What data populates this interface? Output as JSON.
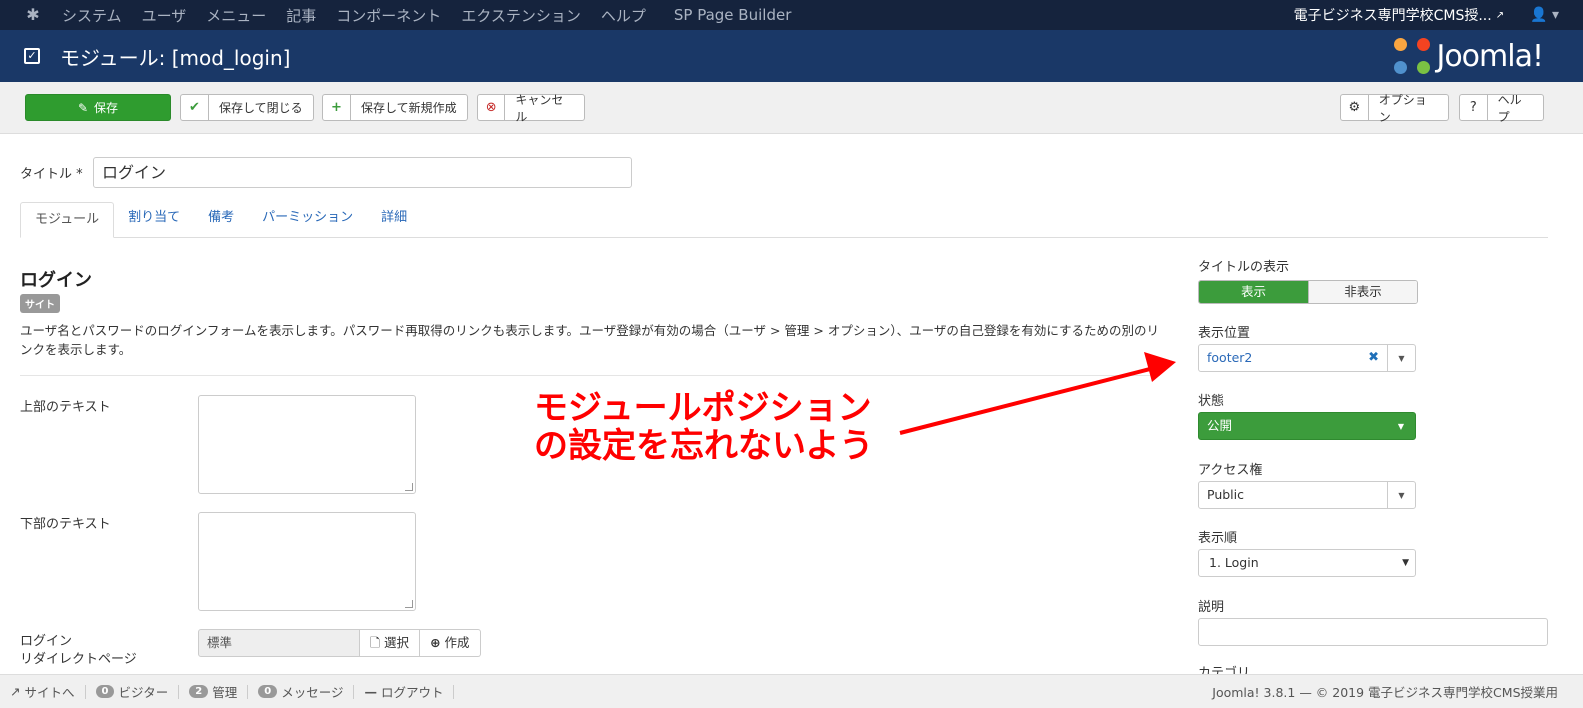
{
  "topnav": {
    "menu": [
      "システム",
      "ユーザ",
      "メニュー",
      "記事",
      "コンポーネント",
      "エクステンション",
      "ヘルプ"
    ],
    "extra": "SP Page Builder",
    "site_name": "電子ビジネス専門学校CMS授...",
    "user_icon": "user-icon"
  },
  "header": {
    "title": "モジュール: [mod_login]",
    "brand": "Joomla!"
  },
  "toolbar": {
    "save": "保存",
    "save_close": "保存して閉じる",
    "save_new": "保存して新規作成",
    "cancel": "キャンセル",
    "options": "オプション",
    "help": "ヘルプ"
  },
  "form": {
    "title_label": "タイトル *",
    "title_value": "ログイン",
    "tabs": [
      "モジュール",
      "割り当て",
      "備考",
      "パーミッション",
      "詳細"
    ],
    "module_name": "ログイン",
    "site_badge": "サイト",
    "description": "ユーザ名とパスワードのログインフォームを表示します。パスワード再取得のリンクも表示します。ユーザ登録が有効の場合（ユーザ > 管理 > オプション）、ユーザの自己登録を有効にするための別のリンクを表示します。",
    "pretext_label": "上部のテキスト",
    "posttext_label": "下部のテキスト",
    "redirect_label_1": "ログイン",
    "redirect_label_2": "リダイレクトページ",
    "redirect_value": "標準",
    "redirect_select": "選択",
    "redirect_create": "作成"
  },
  "sidebar": {
    "show_title_label": "タイトルの表示",
    "show_on": "表示",
    "show_off": "非表示",
    "position_label": "表示位置",
    "position_value": "footer2",
    "status_label": "状態",
    "status_value": "公開",
    "access_label": "アクセス権",
    "access_value": "Public",
    "ordering_label": "表示順",
    "ordering_value": "1. Login",
    "note_label": "説明",
    "category_label": "カテゴリ"
  },
  "annotation": {
    "line1": "モジュールポジション",
    "line2": "の設定を忘れないよう",
    "color": "#ff0000"
  },
  "status": {
    "site": "サイトへ",
    "visitors_count": "0",
    "visitors": "ビジター",
    "admin_count": "2",
    "admin": "管理",
    "messages_count": "0",
    "messages": "メッセージ",
    "logout": "ログアウト",
    "footer": "Joomla! 3.8.1 — © 2019 電子ビジネス専門学校CMS授業用"
  },
  "colors": {
    "topnav": "#15233d",
    "header": "#1a3867",
    "success": "#3c9c3c",
    "link": "#2a69b8"
  }
}
